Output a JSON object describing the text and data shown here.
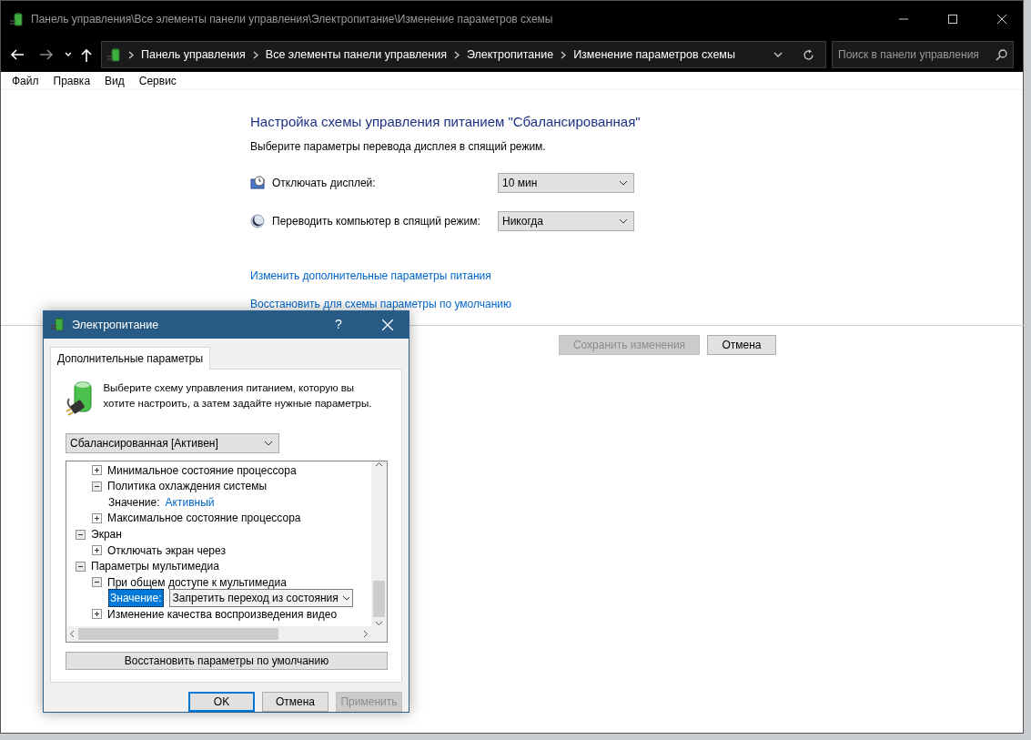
{
  "window": {
    "title": "Панель управления\\Все элементы панели управления\\Электропитание\\Изменение параметров схемы"
  },
  "address_bar": {
    "breadcrumbs": [
      "Панель управления",
      "Все элементы панели управления",
      "Электропитание",
      "Изменение параметров схемы"
    ],
    "search_placeholder": "Поиск в панели управления"
  },
  "menu": [
    "Файл",
    "Правка",
    "Вид",
    "Сервис"
  ],
  "content": {
    "heading": "Настройка схемы управления питанием \"Сбалансированная\"",
    "subtitle": "Выберите параметры перевода дисплея в спящий режим.",
    "settings": [
      {
        "kind": "display",
        "label": "Отключать дисплей:",
        "value": "10 мин"
      },
      {
        "kind": "sleep",
        "label": "Переводить компьютер в спящий режим:",
        "value": "Никогда"
      }
    ],
    "links": [
      "Изменить дополнительные параметры питания",
      "Восстановить для схемы параметры по умолчанию"
    ],
    "buttons": [
      {
        "label": "Сохранить изменения",
        "disabled": true
      },
      {
        "label": "Отмена",
        "disabled": false
      }
    ]
  },
  "dialog": {
    "title": "Электропитание",
    "help": "?",
    "tabs": [
      {
        "label": "Дополнительные параметры",
        "selected": true
      }
    ],
    "intro": "Выберите схему управления питанием, которую вы хотите настроить, а затем задайте нужные параметры.",
    "scheme": "Сбалансированная [Активен]",
    "tree": [
      {
        "children": [
          {
            "label": "Минимальное состояние процессора",
            "expanded": false
          },
          {
            "label": "Политика охлаждения системы",
            "expanded": true,
            "children": [
              {
                "kind": "value",
                "label": "Значение:",
                "value": "Активный",
                "editing": false
              }
            ]
          },
          {
            "label": "Максимальное состояние процессора",
            "expanded": false
          }
        ]
      },
      {
        "label": "Экран",
        "expanded": true,
        "children": [
          {
            "label": "Отключать экран через",
            "expanded": false
          }
        ]
      },
      {
        "label": "Параметры мультимедиа",
        "expanded": true,
        "children": [
          {
            "label": "При общем доступе к мультимедиа",
            "expanded": true,
            "children": [
              {
                "kind": "value",
                "label": "Значение:",
                "value": "Запретить переход из состояния",
                "editing": true
              }
            ]
          },
          {
            "label": "Изменение качества воспроизведения видео",
            "expanded": false
          }
        ]
      }
    ],
    "restore_button": "Восстановить параметры по умолчанию",
    "buttons": [
      {
        "label": "OK",
        "disabled": false,
        "default": true
      },
      {
        "label": "Отмена",
        "disabled": false,
        "default": false
      },
      {
        "label": "Применить",
        "disabled": true,
        "default": false
      }
    ]
  }
}
